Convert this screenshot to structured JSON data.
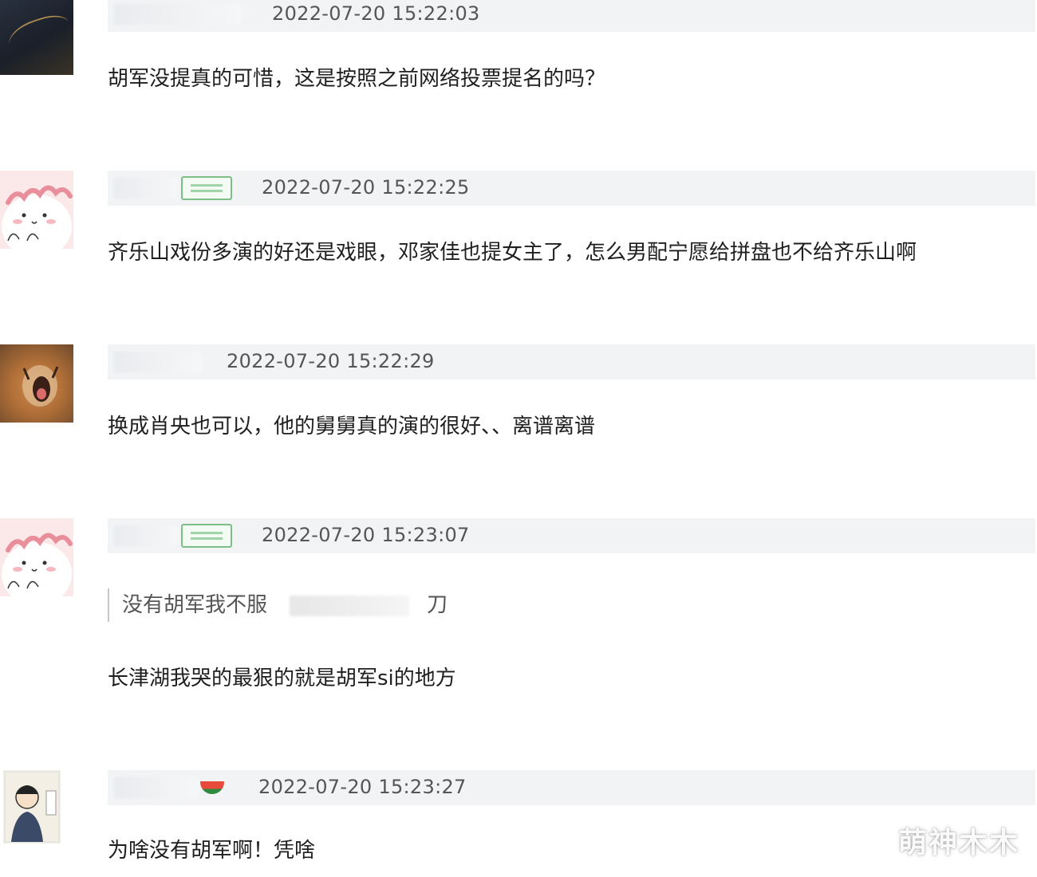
{
  "comments": [
    {
      "username": "",
      "timestamp": "2022-07-20 15:22:03",
      "text": "胡军没提真的可惜，这是按照之前网络投票提名的吗？",
      "avatar": "night-scene-avatar"
    },
    {
      "username": "",
      "timestamp": "2022-07-20 15:22:25",
      "text": "齐乐山戏份多演的好还是戏眼，邓家佳也提女主了，怎么男配宁愿给拼盘也不给齐乐山啊",
      "avatar": "pink-bun-avatar",
      "badge": true
    },
    {
      "username": "",
      "timestamp": "2022-07-20 15:22:29",
      "text": "换成肖央也可以，他的舅舅真的演的很好、、离谱离谱",
      "avatar": "shouting-cat-avatar"
    },
    {
      "username": "",
      "timestamp": "2022-07-20 15:23:07",
      "quote": {
        "text": "没有胡军我不服",
        "suffix": "刀"
      },
      "text": "长津湖我哭的最狠的就是胡军si的地方",
      "avatar": "pink-bun-avatar",
      "badge": true
    },
    {
      "username": "",
      "timestamp": "2022-07-20 15:23:27",
      "text": "为啥没有胡军啊！凭啥",
      "avatar": "cartoon-man-avatar",
      "emoji": "watermelon-icon"
    }
  ],
  "watermark": "萌神木木",
  "colors": {
    "header_bg": "#f1f3f5",
    "badge_green": "#7bbf86",
    "text": "#1f1f1f",
    "timestamp": "#555555"
  }
}
